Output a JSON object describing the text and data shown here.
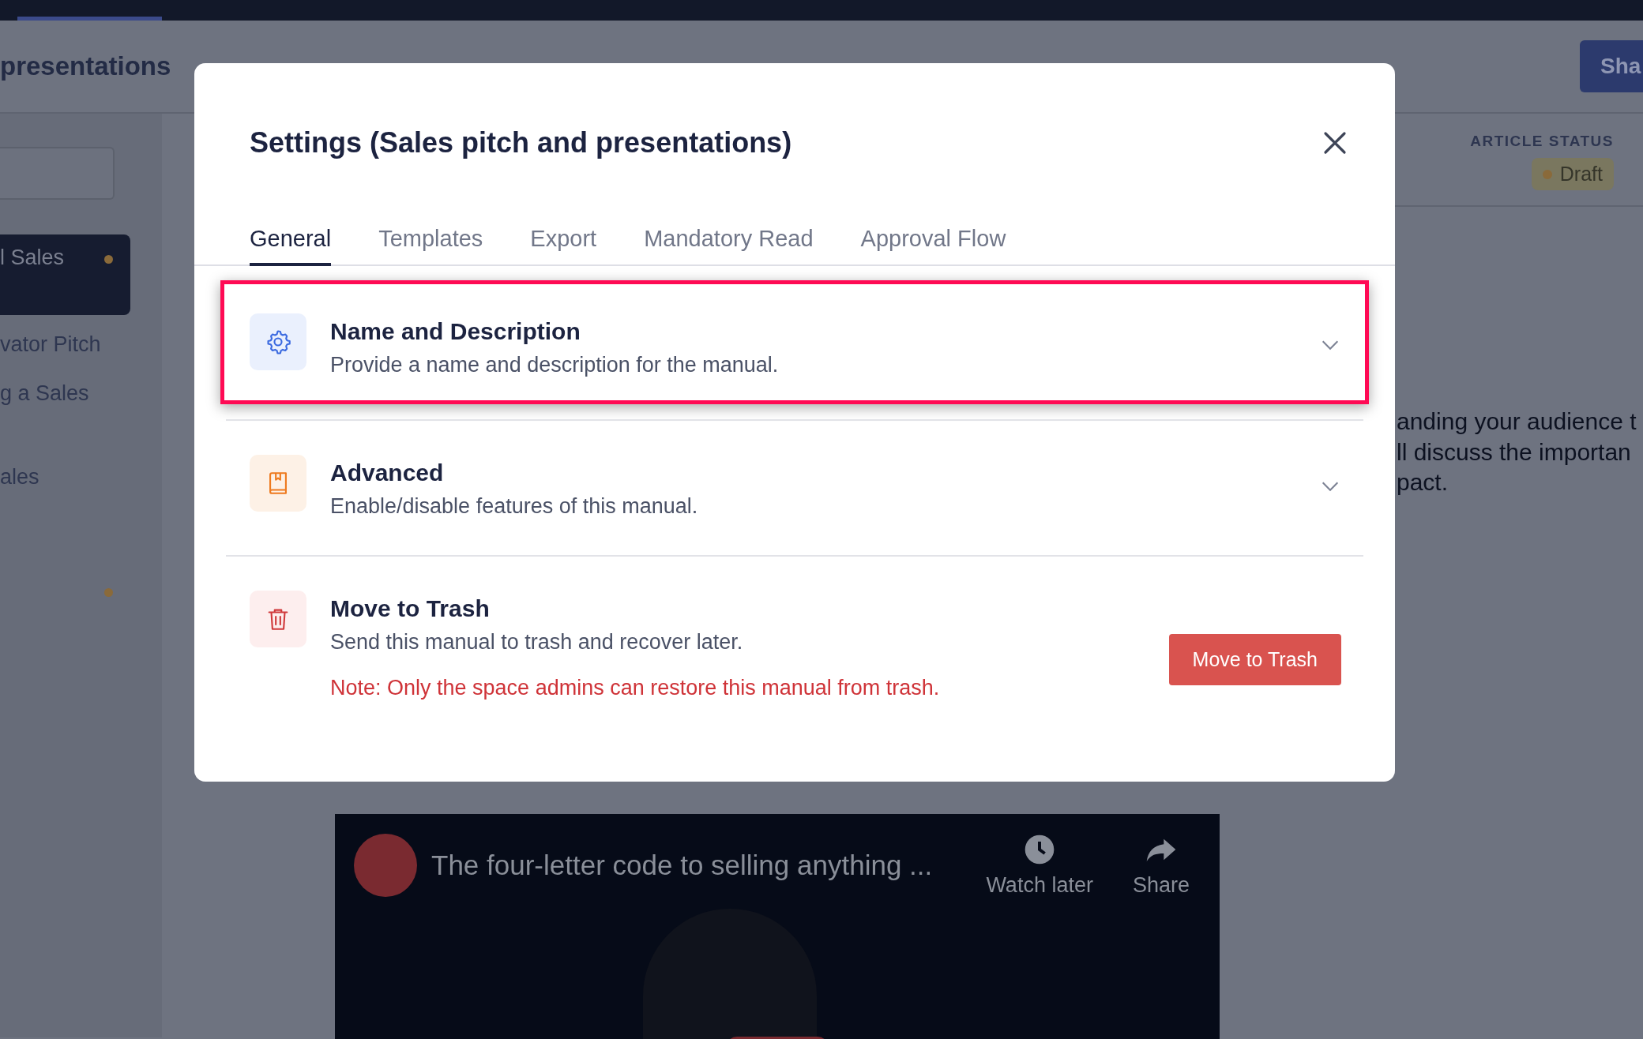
{
  "header": {
    "title": "presentations",
    "share_button": "Sha"
  },
  "sidebar": {
    "items": [
      {
        "label": "l Sales",
        "selected": true,
        "marked": true
      },
      {
        "label": "vator Pitch",
        "selected": false,
        "marked": false
      },
      {
        "label": "g a Sales",
        "selected": false,
        "marked": false
      },
      {
        "label": "ales",
        "selected": false,
        "marked": false
      },
      {
        "selected": false,
        "marked": true
      }
    ]
  },
  "article_status": {
    "label": "ARTICLE STATUS",
    "status": "Draft"
  },
  "article_text": [
    "anding your audience t",
    "ll discuss the importan",
    "pact."
  ],
  "modal": {
    "title": "Settings (Sales pitch and presentations)",
    "tabs": [
      {
        "label": "General",
        "selected": true
      },
      {
        "label": "Templates",
        "selected": false
      },
      {
        "label": "Export",
        "selected": false
      },
      {
        "label": "Mandatory Read",
        "selected": false
      },
      {
        "label": "Approval Flow",
        "selected": false
      }
    ],
    "sections": [
      {
        "kind": "expandable",
        "title": "Name and Description",
        "description": "Provide a name and description for the manual.",
        "expanded": false,
        "highlighted": true
      },
      {
        "kind": "expandable",
        "title": "Advanced",
        "description": "Enable/disable features of this manual.",
        "expanded": false,
        "highlighted": false
      },
      {
        "kind": "action",
        "title": "Move to Trash",
        "description": "Send this manual to trash and recover later.",
        "button": "Move to Trash",
        "note": "Note: Only the space admins can restore this manual from trash.",
        "highlighted": false
      }
    ]
  },
  "video": {
    "title": "The four-letter code to selling anything ...",
    "actions": [
      "Watch later",
      "Share"
    ]
  }
}
